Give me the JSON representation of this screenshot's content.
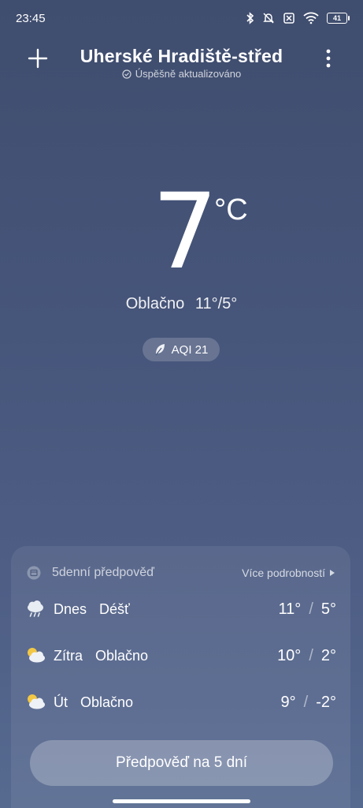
{
  "status": {
    "time": "23:45",
    "battery": "41"
  },
  "header": {
    "city": "Uherské Hradiště-střed",
    "updated": "Úspěšně aktualizováno"
  },
  "current": {
    "temp": "7",
    "unit": "°C",
    "condition": "Oblačno",
    "range": "11°/5°",
    "aqi": "AQI 21"
  },
  "forecast": {
    "title": "5denní předpověď",
    "more": "Více podrobností",
    "rows": [
      {
        "day": "Dnes",
        "condition": "Déšť",
        "high": "11°",
        "low": "5°",
        "icon": "rain-cloud-icon"
      },
      {
        "day": "Zítra",
        "condition": "Oblačno",
        "high": "10°",
        "low": "2°",
        "icon": "partly-cloudy-icon"
      },
      {
        "day": "Út",
        "condition": "Oblačno",
        "high": "9°",
        "low": "-2°",
        "icon": "partly-cloudy-icon"
      }
    ],
    "slash": "/"
  },
  "cta": {
    "label": "Předpověď na 5 dní"
  },
  "colors": {
    "bg_top": "#3f4d6e",
    "bg_bottom": "#566a90"
  }
}
